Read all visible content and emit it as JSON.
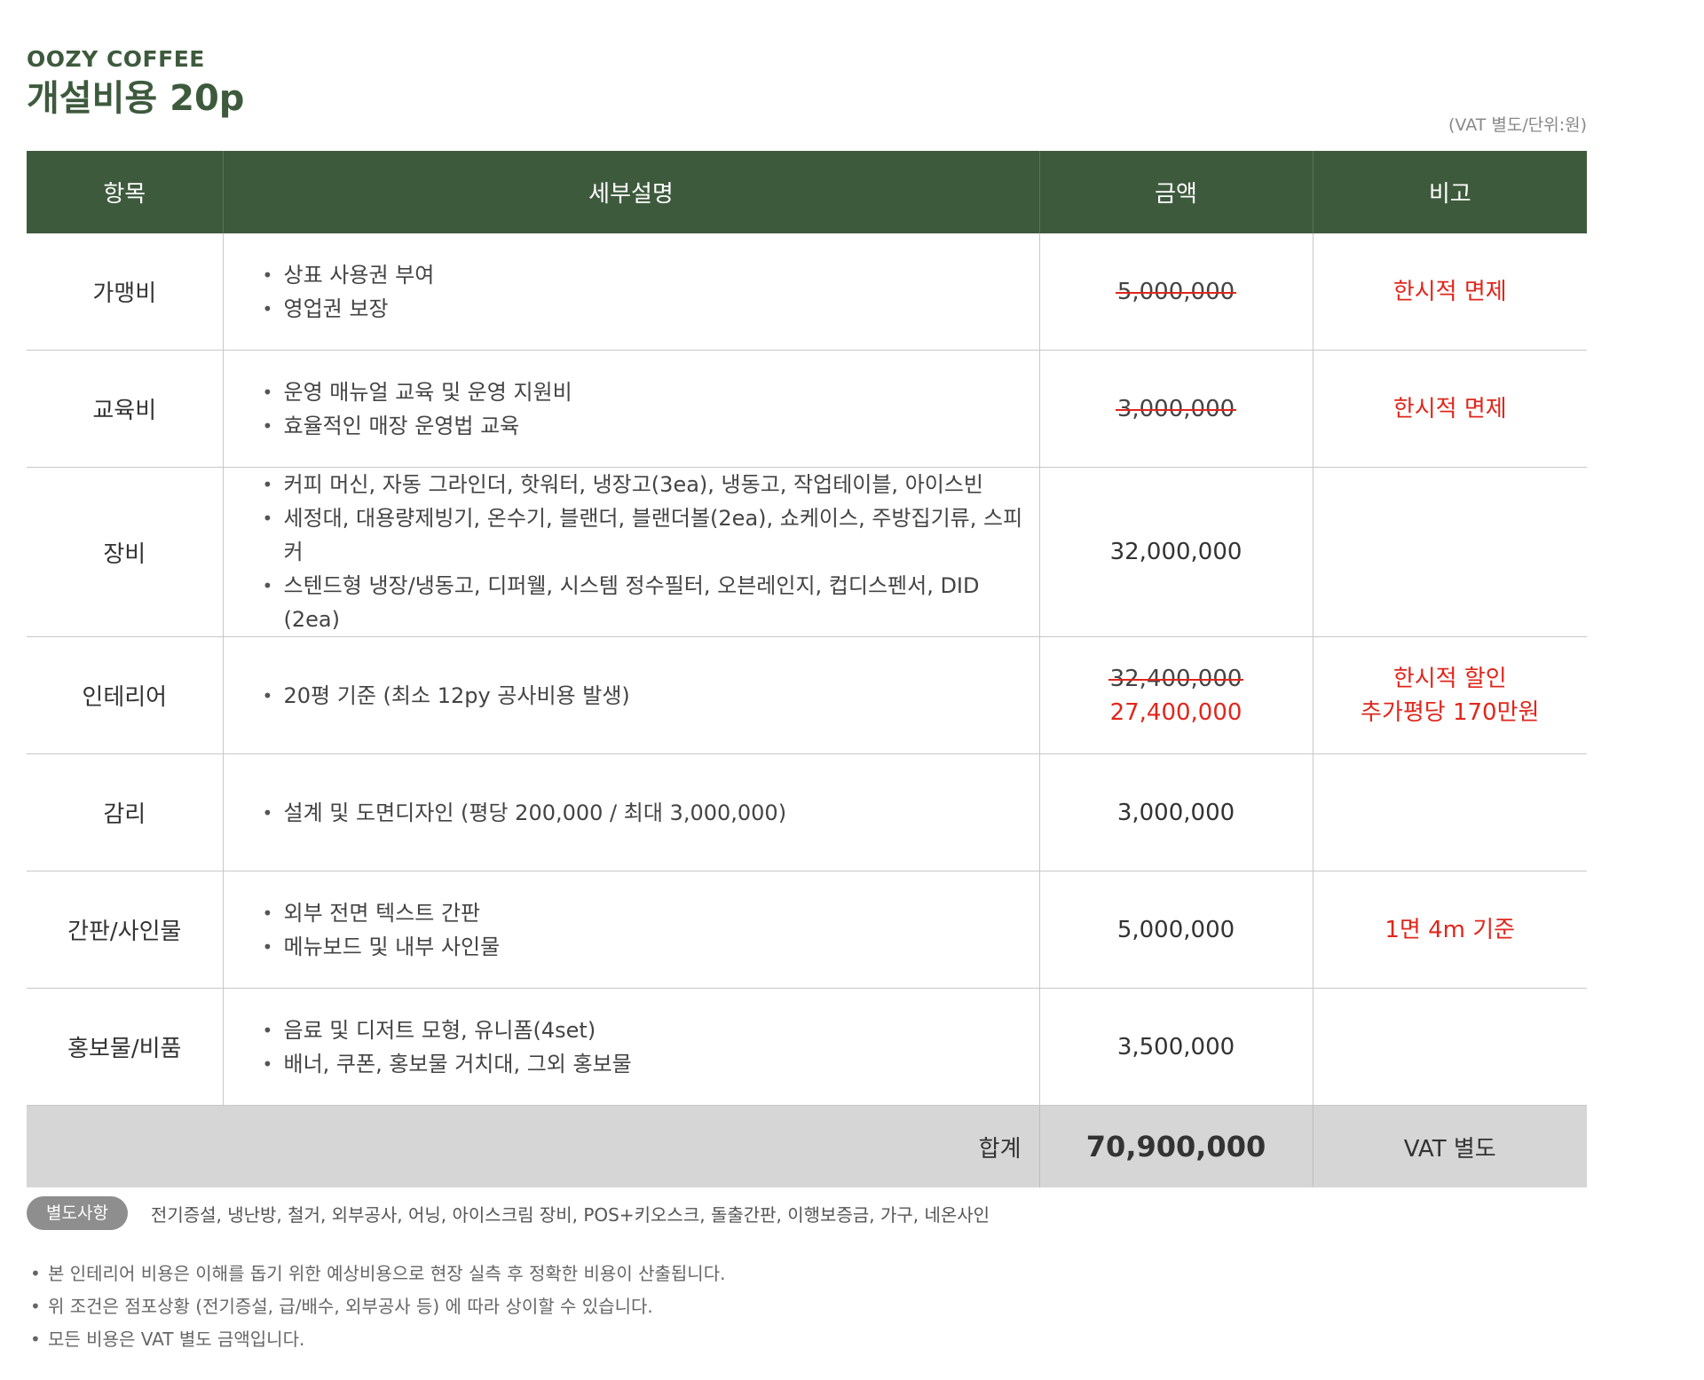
{
  "header": {
    "brand": "OOZY COFFEE",
    "title": "개설비용 20p",
    "unit_note": "(VAT 별도/단위:원)"
  },
  "table": {
    "columns": [
      "항목",
      "세부설명",
      "금액",
      "비고"
    ],
    "rows": [
      {
        "item": "가맹비",
        "details": [
          "상표 사용권 부여",
          "영업권 보장"
        ],
        "amount_original": "5,000,000",
        "note": [
          "한시적 면제"
        ]
      },
      {
        "item": "교육비",
        "details": [
          "운영 매뉴얼 교육 및 운영 지원비",
          "효율적인 매장 운영법 교육"
        ],
        "amount_original": "3,000,000",
        "note": [
          "한시적 면제"
        ]
      },
      {
        "item": "장비",
        "details": [
          "커피 머신, 자동 그라인더, 핫워터, 냉장고(3ea), 냉동고, 작업테이블, 아이스빈",
          "세정대, 대용량제빙기, 온수기, 블랜더, 블랜더볼(2ea), 쇼케이스, 주방집기류, 스피커",
          "스텐드형 냉장/냉동고, 디퍼웰, 시스템 정수필터, 오븐레인지, 컵디스펜서, DID (2ea)"
        ],
        "amount": "32,000,000"
      },
      {
        "item": "인테리어",
        "details": [
          "20평 기준 (최소 12py 공사비용 발생)"
        ],
        "amount_original": "32,400,000",
        "amount_discounted": "27,400,000",
        "note": [
          "한시적 할인",
          "추가평당 170만원"
        ]
      },
      {
        "item": "감리",
        "details": [
          "설계 및 도면디자인 (평당 200,000 / 최대 3,000,000)"
        ],
        "amount": "3,000,000"
      },
      {
        "item": "간판/사인물",
        "details": [
          "외부 전면 텍스트 간판",
          "메뉴보드 및 내부 사인물"
        ],
        "amount": "5,000,000",
        "note": [
          "1면 4m 기준"
        ]
      },
      {
        "item": "홍보물/비품",
        "details": [
          "음료 및 디저트 모형, 유니폼(4set)",
          "배너, 쿠폰, 홍보물 거치대, 그외 홍보물"
        ],
        "amount": "3,500,000"
      }
    ],
    "total": {
      "label": "합계",
      "amount": "70,900,000",
      "note": "VAT 별도"
    }
  },
  "extras": {
    "badge": "별도사항",
    "text": "전기증설, 냉난방, 철거, 외부공사, 어닝, 아이스크림 장비, POS+키오스크, 돌출간판, 이행보증금, 가구, 네온사인"
  },
  "notes": [
    "본 인테리어 비용은 이해를 돕기 위한 예상비용으로 현장 실측 후 정확한 비용이 산출됩니다.",
    "위 조건은 점포상황 (전기증설, 급/배수, 외부공사 등) 에 따라 상이할 수 있습니다.",
    "모든 비용은 VAT 별도 금액입니다."
  ],
  "colors": {
    "header_bg": "#3e5a3d",
    "accent_red": "#e0261c",
    "total_bg": "#d6d6d6"
  }
}
